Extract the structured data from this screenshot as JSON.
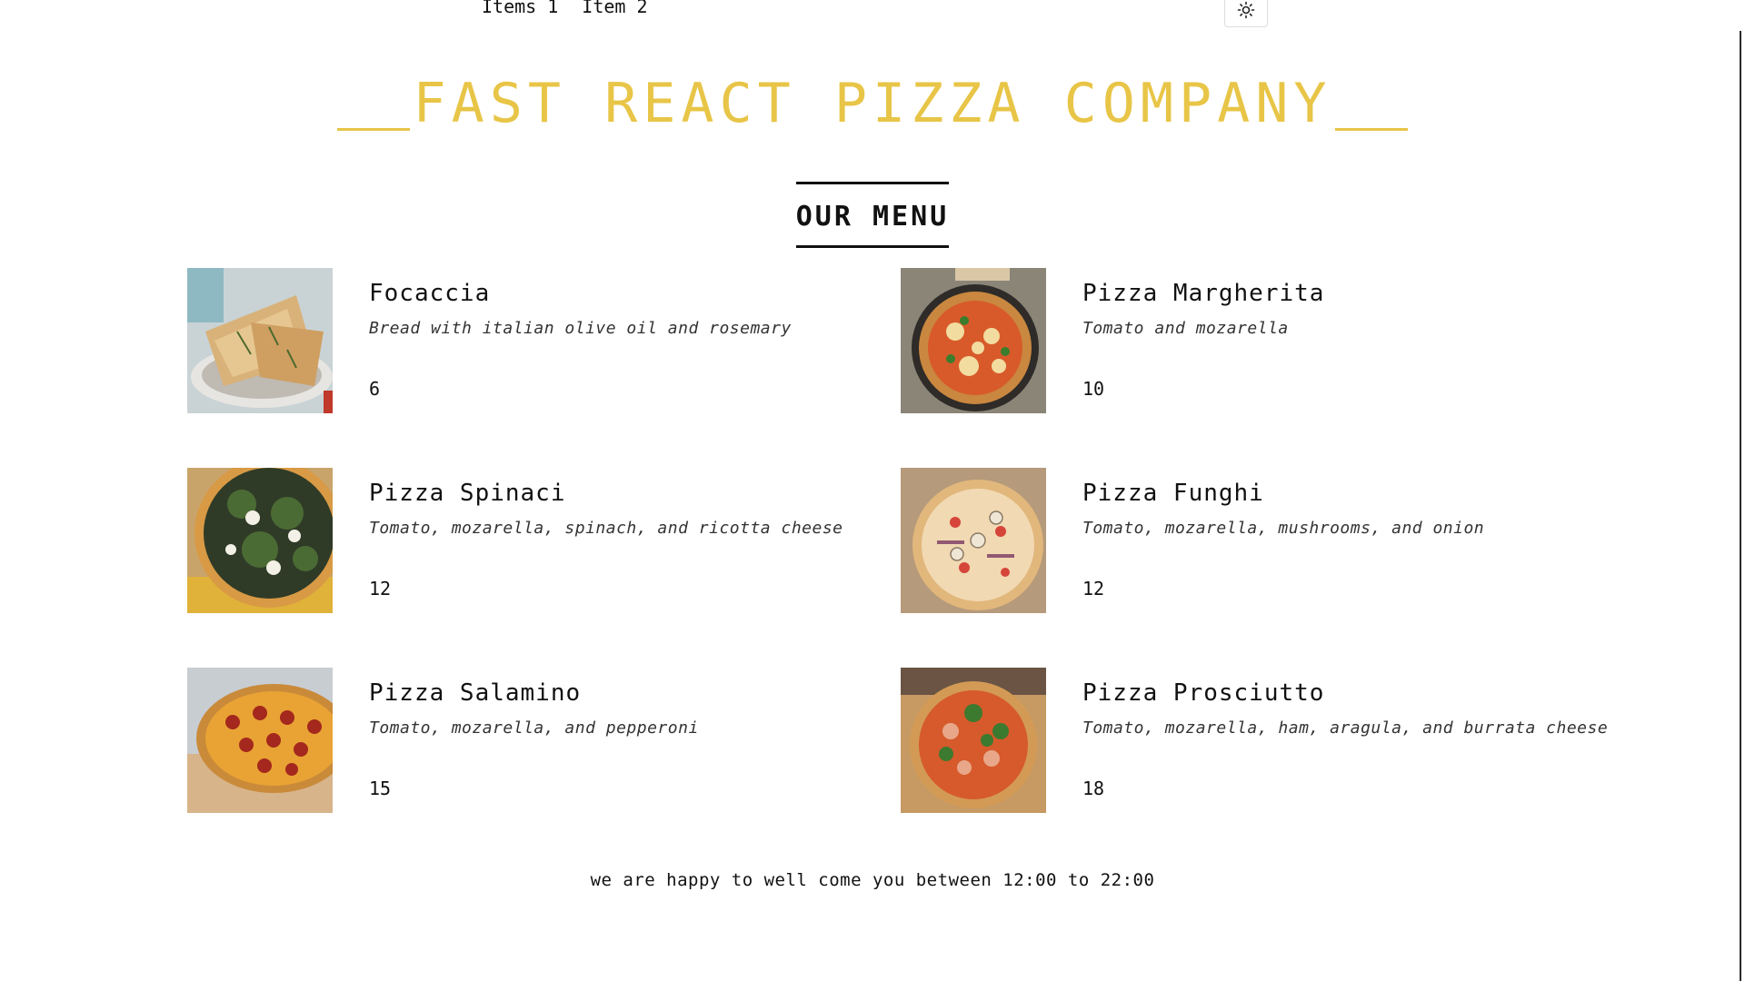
{
  "nav": {
    "items": [
      "Items 1",
      "Item 2"
    ]
  },
  "theme_toggle": {
    "icon": "sun-icon"
  },
  "brand": {
    "title": "FAST REACT PIZZA COMPANY",
    "color": "#e8c547"
  },
  "menu": {
    "title": "OUR MENU",
    "items": [
      {
        "name": "Focaccia",
        "description": "Bread with italian olive oil and rosemary",
        "price": "6",
        "image": "focaccia-photo"
      },
      {
        "name": "Pizza Margherita",
        "description": "Tomato and mozarella",
        "price": "10",
        "image": "margherita-photo"
      },
      {
        "name": "Pizza Spinaci",
        "description": "Tomato, mozarella, spinach, and ricotta cheese",
        "price": "12",
        "image": "spinaci-photo"
      },
      {
        "name": "Pizza Funghi",
        "description": "Tomato, mozarella, mushrooms, and onion",
        "price": "12",
        "image": "funghi-photo"
      },
      {
        "name": "Pizza Salamino",
        "description": "Tomato, mozarella, and pepperoni",
        "price": "15",
        "image": "salamino-photo"
      },
      {
        "name": "Pizza Prosciutto",
        "description": "Tomato, mozarella, ham, aragula, and burrata cheese",
        "price": "18",
        "image": "prosciutto-photo"
      }
    ]
  },
  "footer": {
    "text": "we are happy to well come you between 12:00 to 22:00"
  }
}
